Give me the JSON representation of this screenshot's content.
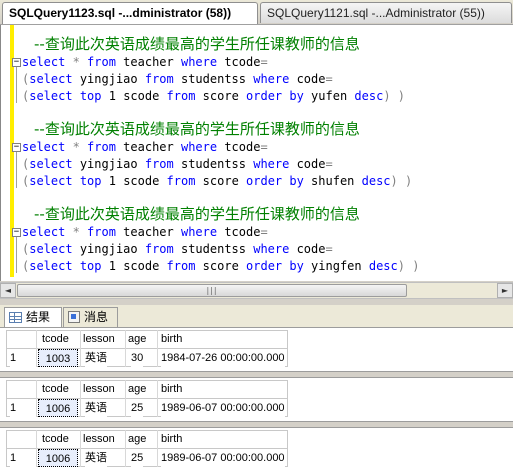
{
  "tabs": [
    {
      "label": "SQLQuery1123.sql -...dministrator (58))",
      "active": true
    },
    {
      "label": "SQLQuery1121.sql -...Administrator (55))",
      "active": false
    }
  ],
  "code_blocks": [
    {
      "comment": "--查询此次英语成绩最高的学生所任课教师的信息",
      "line1": {
        "kw1": "select",
        "op1": " * ",
        "kw2": "from",
        "id1": " teacher ",
        "kw3": "where",
        "id2": " tcode",
        "op2": "="
      },
      "line2": {
        "op1": "(",
        "kw1": "select",
        "id1": " yingjiao ",
        "kw2": "from",
        "id2": " studentss ",
        "kw3": "where",
        "id3": " code",
        "op2": "="
      },
      "line3": {
        "op1": "(",
        "kw1": "select",
        "kw2": " top",
        "id1": " 1 ",
        "id2": "scode ",
        "kw3": "from",
        "id3": " score ",
        "kw4": "order by",
        "id4": " yufen ",
        "kw5": "desc",
        "op2": ") )"
      }
    },
    {
      "comment": "--查询此次英语成绩最高的学生所任课教师的信息",
      "line1": {
        "kw1": "select",
        "op1": " * ",
        "kw2": "from",
        "id1": " teacher ",
        "kw3": "where",
        "id2": " tcode",
        "op2": "="
      },
      "line2": {
        "op1": "(",
        "kw1": "select",
        "id1": " yingjiao ",
        "kw2": "from",
        "id2": " studentss ",
        "kw3": "where",
        "id3": " code",
        "op2": "="
      },
      "line3": {
        "op1": "(",
        "kw1": "select",
        "kw2": " top",
        "id1": " 1 ",
        "id2": "scode ",
        "kw3": "from",
        "id3": " score ",
        "kw4": "order by",
        "id4": " shufen ",
        "kw5": "desc",
        "op2": ") )"
      }
    },
    {
      "comment": "--查询此次英语成绩最高的学生所任课教师的信息",
      "line1": {
        "kw1": "select",
        "op1": " * ",
        "kw2": "from",
        "id1": " teacher ",
        "kw3": "where",
        "id2": " tcode",
        "op2": "="
      },
      "line2": {
        "op1": "(",
        "kw1": "select",
        "id1": " yingjiao ",
        "kw2": "from",
        "id2": " studentss ",
        "kw3": "where",
        "id3": " code",
        "op2": "="
      },
      "line3": {
        "op1": "(",
        "kw1": "select",
        "kw2": " top",
        "id1": " 1 ",
        "id2": "scode ",
        "kw3": "from",
        "id3": " score ",
        "kw4": "order by",
        "id4": " yingfen ",
        "kw5": "desc",
        "op2": ") )"
      }
    }
  ],
  "scrollbar": {
    "left_arrow": "◄",
    "right_arrow": "►",
    "grip": "|||"
  },
  "result_tabs": [
    {
      "label": "结果",
      "icon": "grid-icon",
      "active": true
    },
    {
      "label": "消息",
      "icon": "message-icon",
      "active": false
    }
  ],
  "columns": [
    "tcode",
    "lesson",
    "age",
    "birth"
  ],
  "result_sets": [
    {
      "row_number": "1",
      "tcode": "1003",
      "lesson": "英语",
      "age": "30",
      "birth": "1984-07-26 00:00:00.000"
    },
    {
      "row_number": "1",
      "tcode": "1006",
      "lesson": "英语",
      "age": "25",
      "birth": "1989-06-07 00:00:00.000"
    },
    {
      "row_number": "1",
      "tcode": "1006",
      "lesson": "英语",
      "age": "25",
      "birth": "1989-06-07 00:00:00.000"
    }
  ]
}
